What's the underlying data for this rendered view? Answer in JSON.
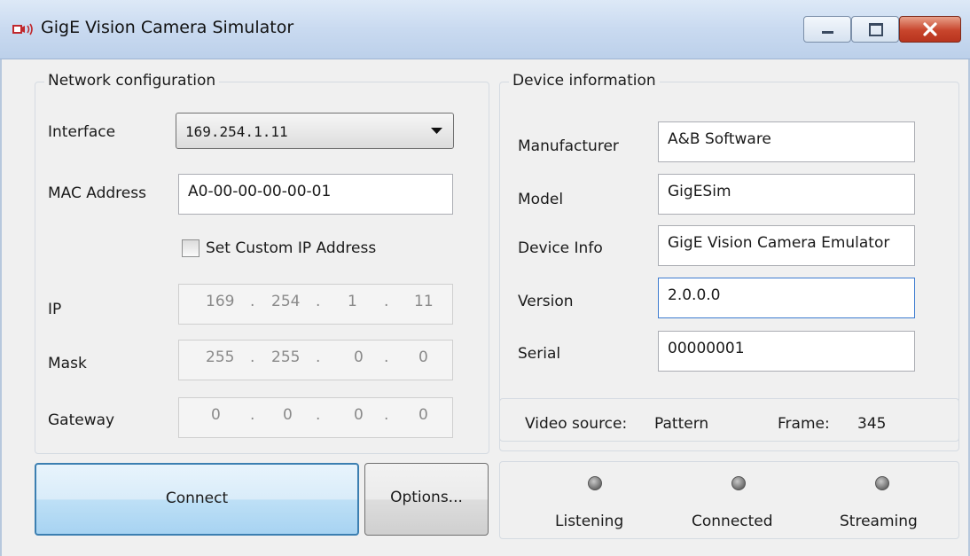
{
  "window": {
    "title": "GigE Vision Camera Simulator"
  },
  "network": {
    "legend": "Network configuration",
    "interface_label": "Interface",
    "interface_value": "169.254.1.11",
    "mac_label": "MAC Address",
    "mac_value": "A0-00-00-00-00-01",
    "custom_ip_label": "Set Custom IP Address",
    "custom_ip_checked": false,
    "ip_label": "IP",
    "ip": [
      "169",
      "254",
      "1",
      "11"
    ],
    "mask_label": "Mask",
    "mask": [
      "255",
      "255",
      "0",
      "0"
    ],
    "gateway_label": "Gateway",
    "gateway": [
      "0",
      "0",
      "0",
      "0"
    ]
  },
  "device": {
    "legend": "Device information",
    "manufacturer_label": "Manufacturer",
    "manufacturer_value": "A&B Software",
    "model_label": "Model",
    "model_value": "GigESim",
    "info_label": "Device Info",
    "info_value": "GigE Vision Camera Emulator",
    "version_label": "Version",
    "version_value": "2.0.0.0",
    "serial_label": "Serial",
    "serial_value": "00000001"
  },
  "video": {
    "source_label": "Video source:",
    "source_value": "Pattern",
    "frame_label": "Frame:",
    "frame_value": "345"
  },
  "buttons": {
    "connect": "Connect",
    "options": "Options..."
  },
  "status": {
    "listening": "Listening",
    "connected": "Connected",
    "streaming": "Streaming"
  },
  "colors": {
    "accent": "#3c7fb1",
    "close": "#c8452c"
  }
}
